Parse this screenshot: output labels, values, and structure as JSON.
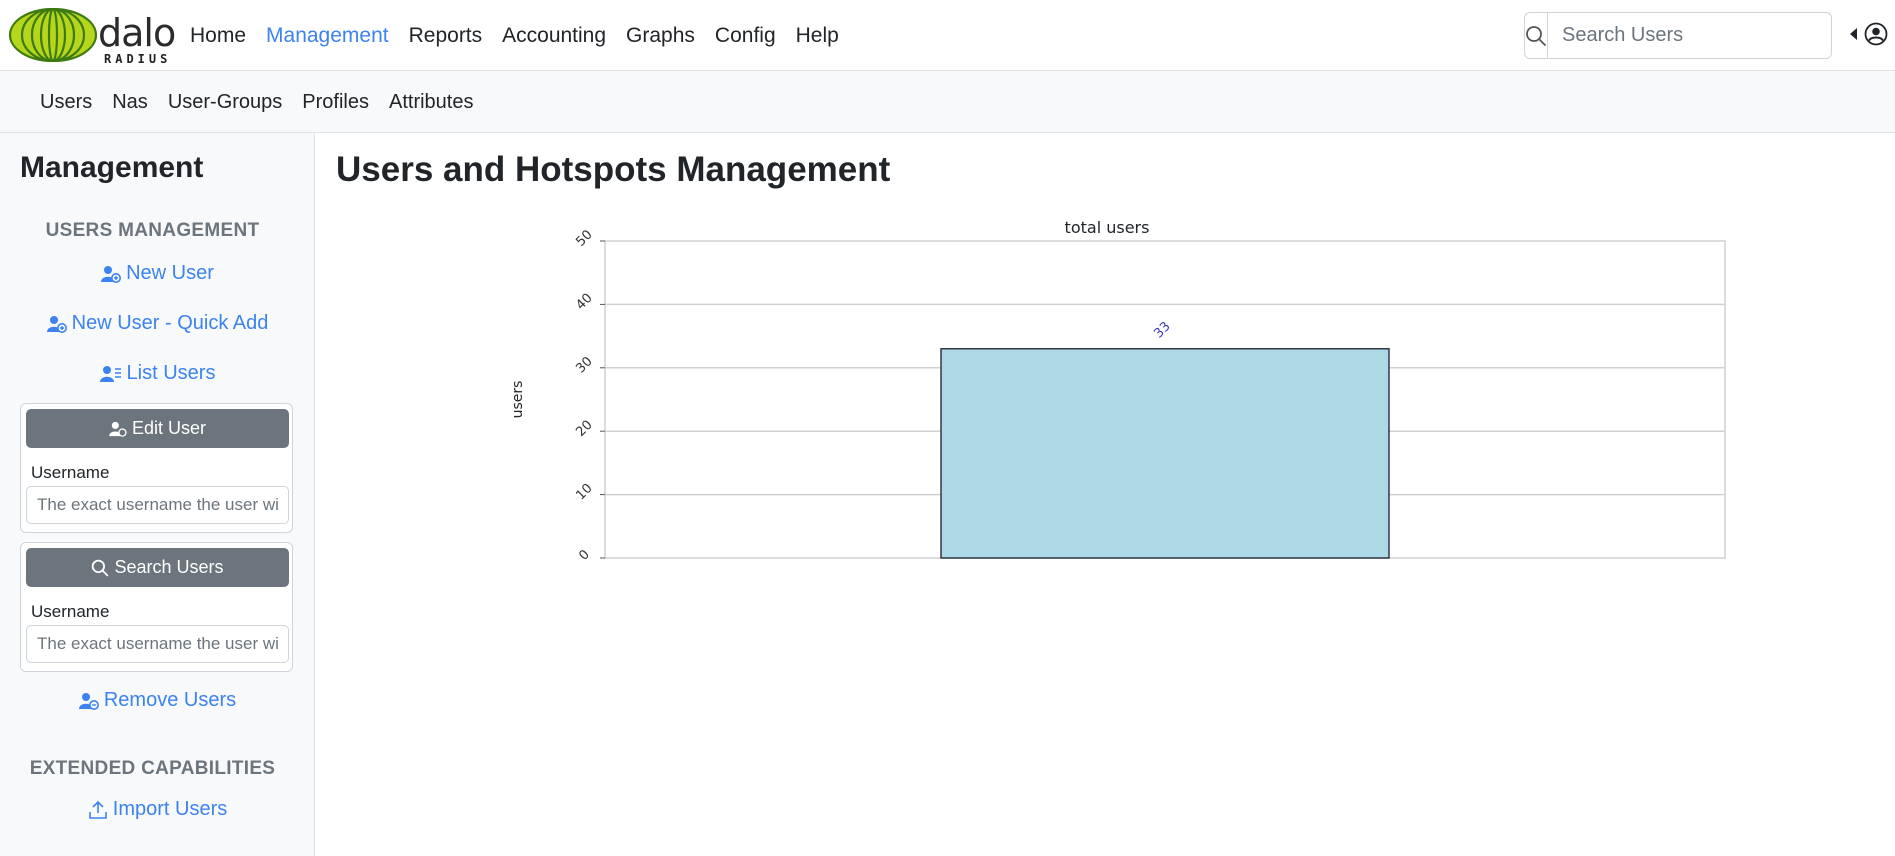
{
  "brand": {
    "word": "dalo",
    "sub": "RADIUS"
  },
  "nav": {
    "items": [
      {
        "label": "Home",
        "active": false
      },
      {
        "label": "Management",
        "active": true
      },
      {
        "label": "Reports",
        "active": false
      },
      {
        "label": "Accounting",
        "active": false
      },
      {
        "label": "Graphs",
        "active": false
      },
      {
        "label": "Config",
        "active": false
      },
      {
        "label": "Help",
        "active": false
      }
    ],
    "search_placeholder": "Search Users",
    "search_icon": "search-icon",
    "user_icon": "user-circle-icon"
  },
  "subnav": {
    "items": [
      "Users",
      "Nas",
      "User-Groups",
      "Profiles",
      "Attributes"
    ]
  },
  "sidebar": {
    "title": "Management",
    "users_section": "Users Management",
    "new_user": "New User",
    "quick_add": "New User - Quick Add",
    "list_users": "List Users",
    "edit_card": {
      "button": "Edit User",
      "label": "Username",
      "placeholder": "The exact username the user wi"
    },
    "search_card": {
      "button": "Search Users",
      "label": "Username",
      "placeholder": "The exact username the user wi"
    },
    "remove_users": "Remove Users",
    "extended_section": "Extended Capabilities",
    "import_users": "Import Users"
  },
  "main": {
    "title": "Users and Hotspots Management"
  },
  "colors": {
    "accent": "#3c82f0",
    "bar": "#add8e6",
    "button": "#6c757d"
  },
  "chart_data": {
    "type": "bar",
    "title": "total users",
    "ylabel": "users",
    "xlabel": "",
    "categories": [
      ""
    ],
    "values": [
      33
    ],
    "data_labels": [
      "33"
    ],
    "ylim": [
      0,
      50
    ],
    "yticks": [
      "0",
      "10",
      "20",
      "30",
      "40",
      "50"
    ],
    "grid": true
  }
}
